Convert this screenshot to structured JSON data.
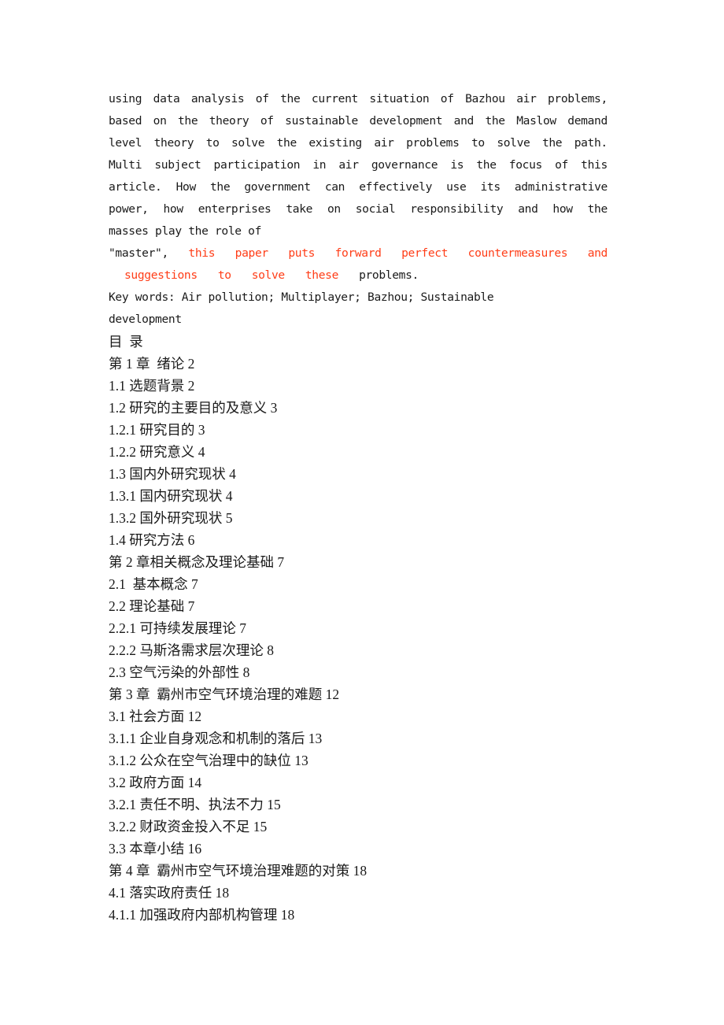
{
  "document": {
    "type": "thesis-abstract-and-contents",
    "background_color": "#ffffff",
    "text_color": "#1a1a1a",
    "highlight_color": "#ff3d17"
  },
  "abstract": {
    "lines": [
      {
        "id": "l1",
        "justified": true,
        "words": [
          "using",
          "data",
          "analysis",
          "of",
          "the",
          "current",
          "situation",
          "of",
          "Bazhou",
          "air",
          "problems,"
        ]
      },
      {
        "id": "l2",
        "justified": true,
        "words": [
          "based",
          "on",
          "the",
          "theory",
          "of",
          "sustainable",
          "development",
          "and",
          "the",
          "Maslow",
          "demand"
        ]
      },
      {
        "id": "l3",
        "justified": true,
        "words": [
          "level",
          "theory",
          "to",
          "solve",
          "the",
          "existing",
          "air",
          "problems",
          "to",
          "solve",
          "the",
          "path."
        ]
      },
      {
        "id": "l4",
        "justified": true,
        "words": [
          "Multi",
          "subject",
          "participation",
          "in",
          "air",
          "governance",
          "is",
          "the",
          "focus",
          "of",
          "this"
        ]
      },
      {
        "id": "l5",
        "justified": true,
        "words": [
          "article.",
          "How",
          "the",
          "government",
          "can",
          "effectively",
          "use",
          "its",
          "administrative"
        ]
      },
      {
        "id": "l6",
        "justified": true,
        "words": [
          "power,",
          "how",
          "enterprises",
          "take",
          "on",
          "social",
          "responsibility",
          "and",
          "how",
          "the"
        ]
      },
      {
        "id": "l7",
        "justified": false,
        "text": "masses play the role of"
      }
    ],
    "highlighted_line": {
      "lead_black": "\"master\",",
      "red_words": [
        "this",
        "paper",
        "puts",
        "forward",
        "perfect",
        "countermeasures",
        "and"
      ]
    },
    "highlighted_line_2": {
      "red_words": [
        "suggestions",
        "to",
        "solve",
        "these"
      ],
      "trailing_black": "problems."
    },
    "keywords_line_1": "Key words: Air pollution; Multiplayer; Bazhou; Sustainable",
    "keywords_line_2": "development"
  },
  "contents": {
    "heading": "目  录",
    "entries": [
      "第 1 章  绪论 2",
      "1.1 选题背景 2",
      "1.2 研究的主要目的及意义 3",
      "1.2.1 研究目的 3",
      "1.2.2 研究意义 4",
      "1.3 国内外研究现状 4",
      "1.3.1 国内研究现状 4",
      "1.3.2 国外研究现状 5",
      "1.4 研究方法 6",
      "第 2 章相关概念及理论基础 7",
      "2.1  基本概念 7",
      "2.2 理论基础 7",
      "2.2.1 可持续发展理论 7",
      "2.2.2 马斯洛需求层次理论 8",
      "2.3 空气污染的外部性 8",
      "第 3 章  霸州市空气环境治理的难题 12",
      "3.1 社会方面 12",
      "3.1.1 企业自身观念和机制的落后 13",
      "3.1.2 公众在空气治理中的缺位 13",
      "3.2 政府方面 14",
      "3.2.1 责任不明、执法不力 15",
      "3.2.2 财政资金投入不足 15",
      "3.3 本章小结 16",
      "第 4 章  霸州市空气环境治理难题的对策 18",
      "4.1 落实政府责任 18",
      "4.1.1 加强政府内部机构管理 18"
    ]
  }
}
